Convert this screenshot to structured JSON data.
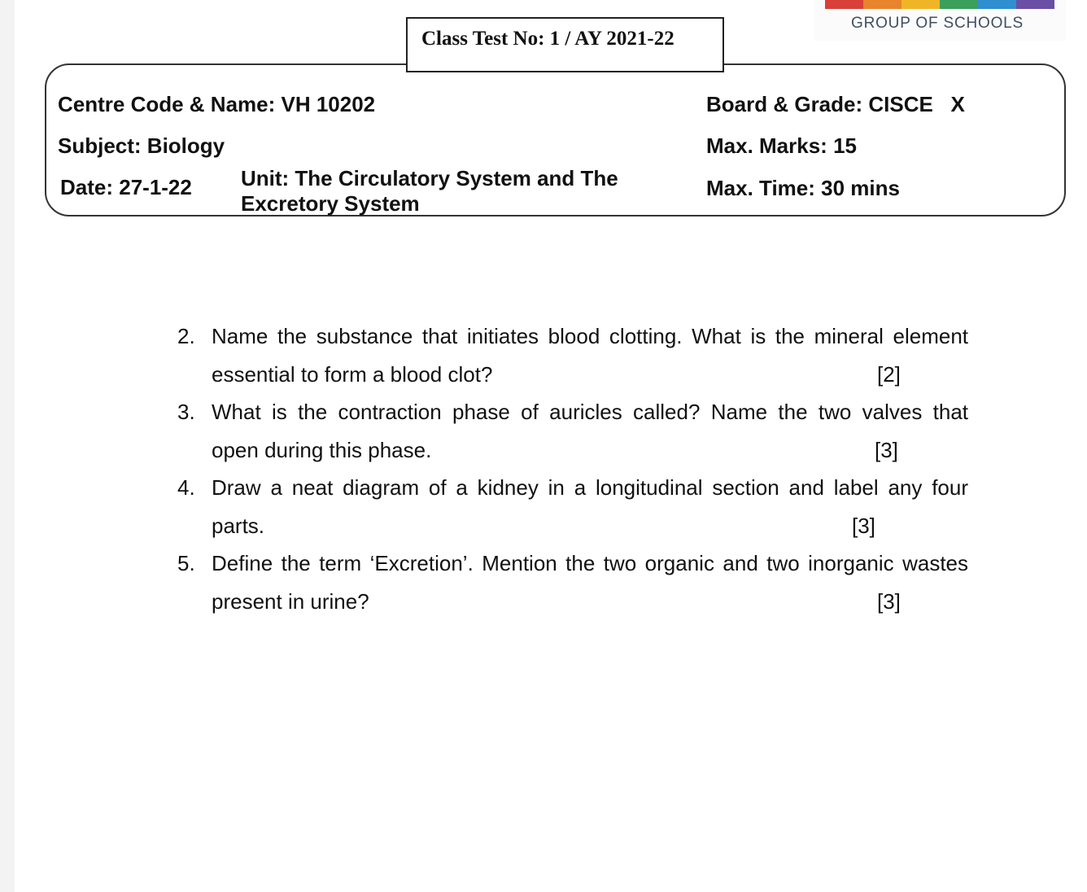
{
  "logo": {
    "text": "GROUP OF SCHOOLS",
    "colors": [
      "#d9403a",
      "#e8842c",
      "#f0b526",
      "#3aa05b",
      "#2f8fd0",
      "#6b4ea5"
    ]
  },
  "header": {
    "test_title": "Class Test No: 1 / AY 2021-22"
  },
  "info": {
    "centre": "Centre Code & Name: VH 10202",
    "board_grade": "Board & Grade: CISCE   X",
    "subject": "Subject: Biology",
    "max_marks": "Max. Marks: 15",
    "date": "Date: 27-1-22",
    "unit_line1": "Unit: The Circulatory System and The",
    "unit_line2": "Excretory System",
    "max_time": "Max. Time: 30 mins"
  },
  "questions": [
    {
      "number": "2.",
      "line1": "Name the substance that initiates blood clotting. What is the mineral element",
      "line2": "essential to form a blood clot?",
      "marks": "[2]"
    },
    {
      "number": "3.",
      "line1": "What is the contraction phase of auricles called? Name the two valves that",
      "line2": "open during this phase.",
      "marks": "[3]"
    },
    {
      "number": "4.",
      "line1": "Draw a neat diagram of a kidney in a longitudinal section and label any four",
      "line2": "parts.",
      "marks": "[3]"
    },
    {
      "number": "5.",
      "line1": "Define the term ‘Excretion’. Mention the two organic and two inorganic wastes",
      "line2": "present in urine?",
      "marks": "[3]"
    }
  ]
}
